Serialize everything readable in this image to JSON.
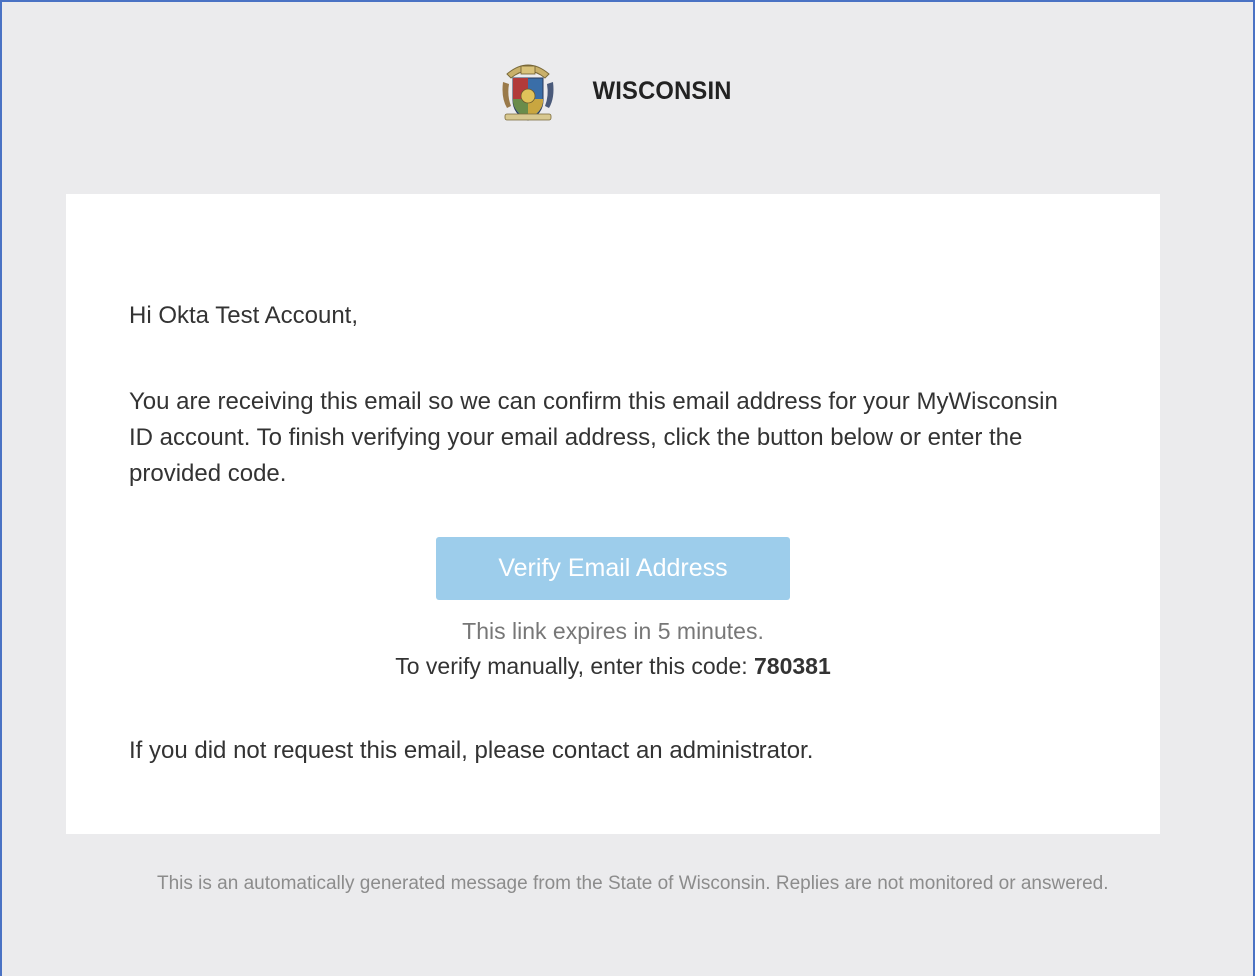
{
  "header": {
    "brand": "WISCONSIN",
    "seal_icon": "wisconsin-state-seal"
  },
  "email": {
    "greeting": "Hi Okta Test Account,",
    "intro": "You are receiving this email so we can confirm this email address for your MyWisconsin ID account. To finish verifying your email address, click the button below or enter the provided code.",
    "button_label": "Verify Email Address",
    "expires_text": "This link expires in 5 minutes.",
    "manual_prefix": "To verify manually, enter this code:",
    "code": "780381",
    "contact_text": "If you did not request this email, please contact an administrator."
  },
  "footer": {
    "text": "This is an automatically generated message from the State of Wisconsin. Replies are not monitored or answered."
  },
  "colors": {
    "background": "#ebebed",
    "card": "#ffffff",
    "button": "#9dcdeb",
    "frame_border": "#4a72c4"
  }
}
